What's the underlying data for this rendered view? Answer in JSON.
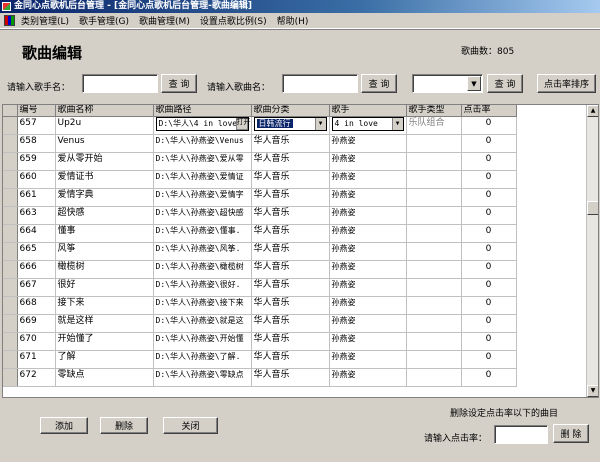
{
  "window": {
    "title": "金同心点歌机后台管理 - [金同心点歌机后台管理-歌曲编辑]"
  },
  "menu": [
    "类别管理(L)",
    "歌手管理(G)",
    "歌曲管理(M)",
    "设置点歌比例(S)",
    "帮助(H)"
  ],
  "page": {
    "title": "歌曲编辑",
    "song_count": "歌曲数：805"
  },
  "search": {
    "singer_label": "请输入歌手名：",
    "singer_value": "",
    "song_label": "请输入歌曲名：",
    "song_value": "",
    "query_label": "查 询",
    "combo_value": "",
    "sort_label": "点击率排序"
  },
  "table": {
    "headers": [
      "编号",
      "歌曲名称",
      "歌曲路径",
      "歌曲分类",
      "歌手",
      "歌手类型",
      "点击率"
    ],
    "editing": {
      "path": "D:\\华人\\4 in love",
      "open_label": "打开",
      "category": "日韩流行",
      "singer": "4 in love",
      "singer_type": "乐队组合"
    },
    "rows": [
      {
        "id": "657",
        "name": "Up2u",
        "path": "",
        "category": "",
        "singer": "",
        "type": "",
        "clicks": "0"
      },
      {
        "id": "658",
        "name": "Venus",
        "path": "D:\\华人\\孙燕姿\\Venus",
        "category": "华人音乐",
        "singer": "孙燕姿",
        "type": "",
        "clicks": "0"
      },
      {
        "id": "659",
        "name": "爱从零开始",
        "path": "D:\\华人\\孙燕姿\\爱从零",
        "category": "华人音乐",
        "singer": "孙燕姿",
        "type": "",
        "clicks": "0"
      },
      {
        "id": "660",
        "name": "爱情证书",
        "path": "D:\\华人\\孙燕姿\\爱情证",
        "category": "华人音乐",
        "singer": "孙燕姿",
        "type": "",
        "clicks": "0"
      },
      {
        "id": "661",
        "name": "爱情字典",
        "path": "D:\\华人\\孙燕姿\\爱情字",
        "category": "华人音乐",
        "singer": "孙燕姿",
        "type": "",
        "clicks": "0"
      },
      {
        "id": "663",
        "name": "超快感",
        "path": "D:\\华人\\孙燕姿\\超快感",
        "category": "华人音乐",
        "singer": "孙燕姿",
        "type": "",
        "clicks": "0"
      },
      {
        "id": "664",
        "name": "懂事",
        "path": "D:\\华人\\孙燕姿\\懂事.",
        "category": "华人音乐",
        "singer": "孙燕姿",
        "type": "",
        "clicks": "0"
      },
      {
        "id": "665",
        "name": "风筝",
        "path": "D:\\华人\\孙燕姿\\风筝.",
        "category": "华人音乐",
        "singer": "孙燕姿",
        "type": "",
        "clicks": "0"
      },
      {
        "id": "666",
        "name": "橄榄树",
        "path": "D:\\华人\\孙燕姿\\橄榄树",
        "category": "华人音乐",
        "singer": "孙燕姿",
        "type": "",
        "clicks": "0"
      },
      {
        "id": "667",
        "name": "很好",
        "path": "D:\\华人\\孙燕姿\\很好.",
        "category": "华人音乐",
        "singer": "孙燕姿",
        "type": "",
        "clicks": "0"
      },
      {
        "id": "668",
        "name": "接下来",
        "path": "D:\\华人\\孙燕姿\\接下来",
        "category": "华人音乐",
        "singer": "孙燕姿",
        "type": "",
        "clicks": "0"
      },
      {
        "id": "669",
        "name": "就是这样",
        "path": "D:\\华人\\孙燕姿\\就是这",
        "category": "华人音乐",
        "singer": "孙燕姿",
        "type": "",
        "clicks": "0"
      },
      {
        "id": "670",
        "name": "开始懂了",
        "path": "D:\\华人\\孙燕姿\\开始懂",
        "category": "华人音乐",
        "singer": "孙燕姿",
        "type": "",
        "clicks": "0"
      },
      {
        "id": "671",
        "name": "了解",
        "path": "D:\\华人\\孙燕姿\\了解.",
        "category": "华人音乐",
        "singer": "孙燕姿",
        "type": "",
        "clicks": "0"
      },
      {
        "id": "672",
        "name": "零缺点",
        "path": "D:\\华人\\孙燕姿\\零缺点",
        "category": "华人音乐",
        "singer": "孙燕姿",
        "type": "",
        "clicks": "0"
      }
    ]
  },
  "footer": {
    "add": "添加",
    "delete": "删除",
    "close": "关闭",
    "bulk_title": "删除设定点击率以下的曲目",
    "clicks_label": "请输入点击率：",
    "clicks_value": "",
    "bulk_delete": "删 除"
  }
}
